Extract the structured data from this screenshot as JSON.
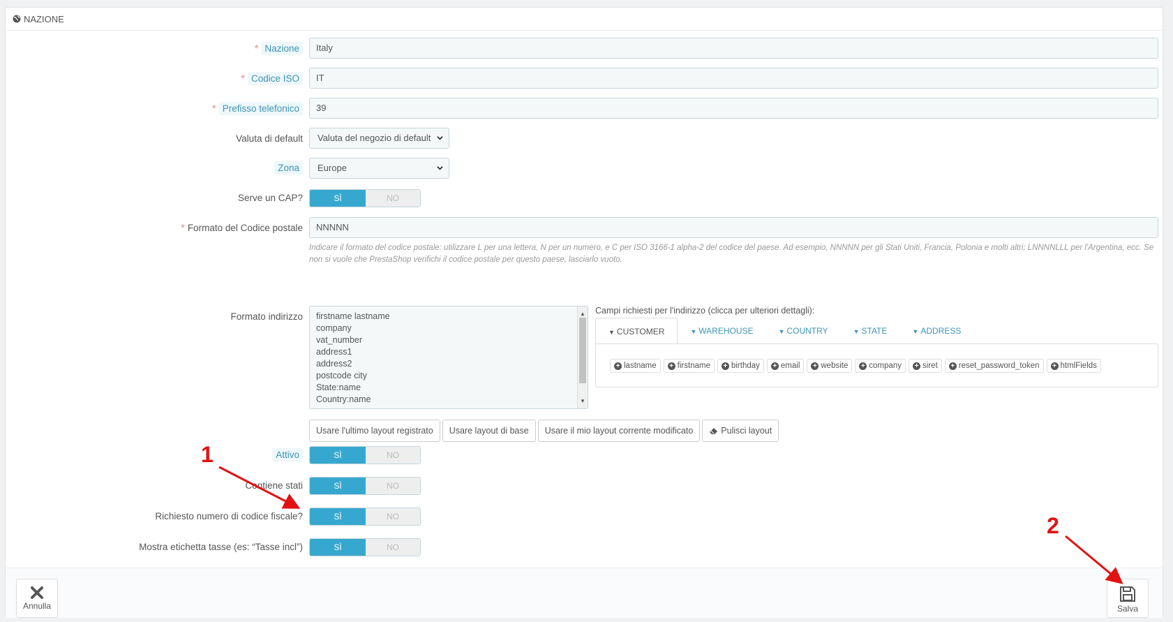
{
  "panel": {
    "title": "NAZIONE"
  },
  "fields": {
    "nazione": {
      "label": "Nazione",
      "value": "Italy"
    },
    "codice_iso": {
      "label": "Codice ISO",
      "value": "IT"
    },
    "prefisso": {
      "label": "Prefisso telefonico",
      "value": "39"
    },
    "valuta": {
      "label": "Valuta di default",
      "value": "Valuta del negozio di default"
    },
    "zona": {
      "label": "Zona",
      "value": "Europe"
    },
    "cap": {
      "label": "Serve un CAP?",
      "on": "SÌ",
      "off": "NO"
    },
    "formato_cap": {
      "label": "Formato del Codice postale",
      "value": "NNNNN",
      "help": "Indicare il formato del codice postale: utilizzare L per una lettera, N per un numero, e C per ISO 3166-1 alpha-2 del codice del paese. Ad esempio, NNNNN per gli Stati Uniti, Francia, Polonia e molti altri; LNNNNLLL per l'Argentina, ecc. Se non si vuole che PrestaShop verifichi il codice postale per questo paese, lasciarlo vuoto."
    },
    "formato_indirizzo": {
      "label": "Formato indirizzo",
      "lines": [
        "firstname lastname",
        "company",
        "vat_number",
        "address1",
        "address2",
        "postcode city",
        "State:name",
        "Country:name"
      ],
      "fields_caption": "Campi richiesti per l'indirizzo (clicca per ulteriori dettagli):",
      "tabs": [
        "CUSTOMER",
        "WAREHOUSE",
        "COUNTRY",
        "STATE",
        "ADDRESS"
      ],
      "chips": [
        "lastname",
        "firstname",
        "birthday",
        "email",
        "website",
        "company",
        "siret",
        "reset_password_token",
        "htmlFields"
      ],
      "buttons": {
        "last": "Usare l'ultimo layout registrato",
        "base": "Usare layout di base",
        "current": "Usare il mio layout corrente modificato",
        "clear": "Pulisci layout"
      }
    },
    "attivo": {
      "label": "Attivo",
      "on": "SÌ",
      "off": "NO"
    },
    "stati": {
      "label": "Contiene stati",
      "on": "SÌ",
      "off": "NO"
    },
    "codice_fiscale": {
      "label": "Richiesto numero di codice fiscale?",
      "on": "SÌ",
      "off": "NO"
    },
    "etichetta_tasse": {
      "label": "Mostra etichetta tasse (es: “Tasse incl”)",
      "on": "SÌ",
      "off": "NO"
    }
  },
  "footer": {
    "cancel": "Annulla",
    "save": "Salva"
  },
  "annotations": {
    "one": "1",
    "two": "2",
    "color": "#e21212"
  },
  "colors": {
    "accent": "#36a8cf",
    "link": "#3e94b3"
  }
}
